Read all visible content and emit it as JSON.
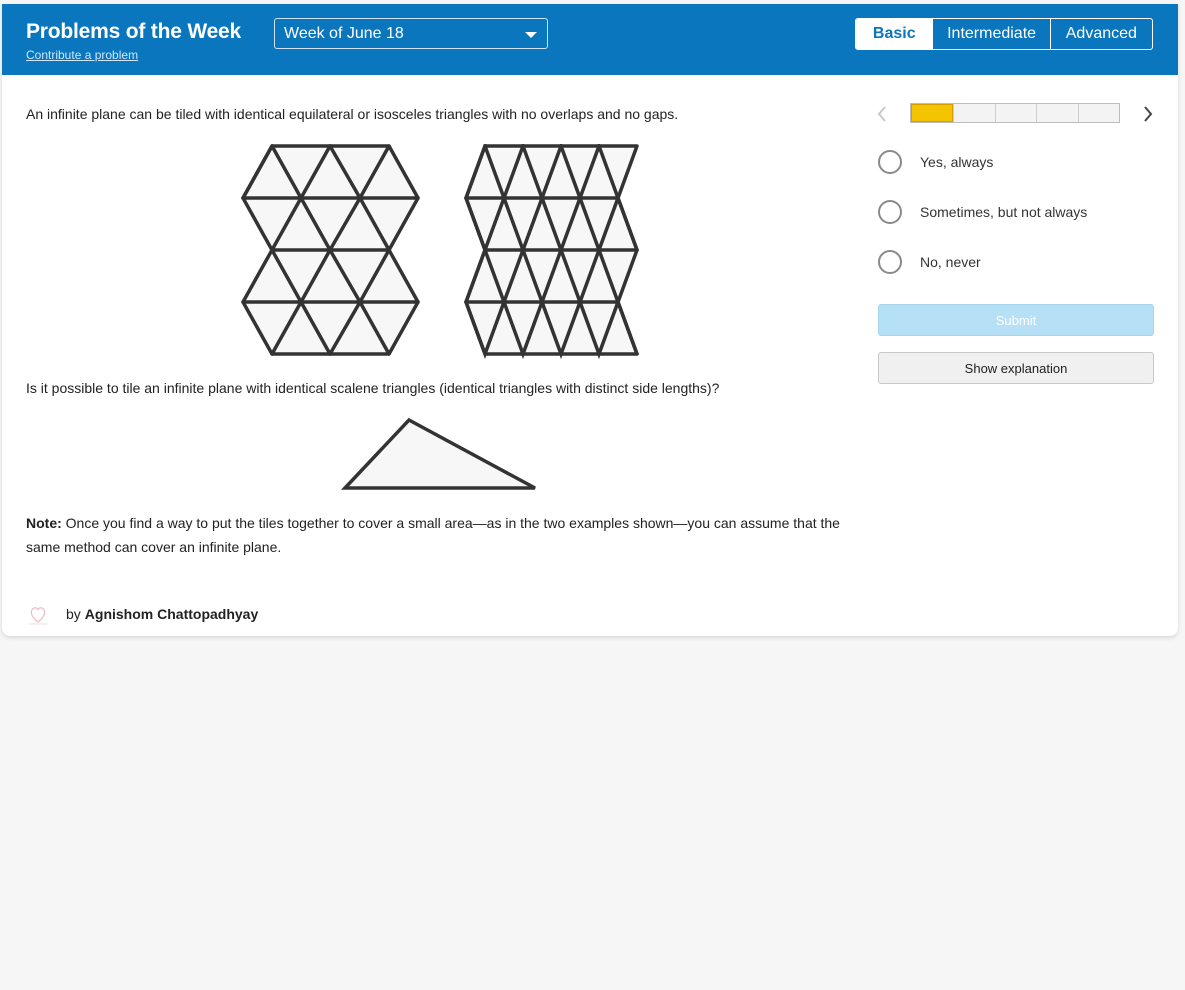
{
  "header": {
    "title": "Problems of the Week",
    "contribute_link": "Contribute a problem",
    "week_selected": "Week of June 18",
    "levels": [
      {
        "label": "Basic",
        "active": true
      },
      {
        "label": "Intermediate",
        "active": false
      },
      {
        "label": "Advanced",
        "active": false
      }
    ]
  },
  "problem": {
    "intro": "An infinite plane can be tiled with identical equilateral or isosceles triangles with no overlaps and no gaps.",
    "question": "Is it possible to tile an infinite plane with identical scalene triangles (identical triangles with distinct side lengths)?",
    "note_label": "Note:",
    "note_text": " Once you find a way to put the tiles together to cover a small area—as in the two examples shown—you can assume that the same method can cover an infinite plane.",
    "author_prefix": "by",
    "author": "Agnishom Chattopadhyay"
  },
  "progress": {
    "segments": 5,
    "current": 1
  },
  "answers": {
    "options": [
      "Yes, always",
      "Sometimes, but not always",
      "No, never"
    ],
    "submit_label": "Submit",
    "explain_label": "Show explanation"
  },
  "colors": {
    "header_bg": "#0a76bd",
    "progress_fill": "#f5c400",
    "submit_disabled": "#b6e0f5"
  }
}
